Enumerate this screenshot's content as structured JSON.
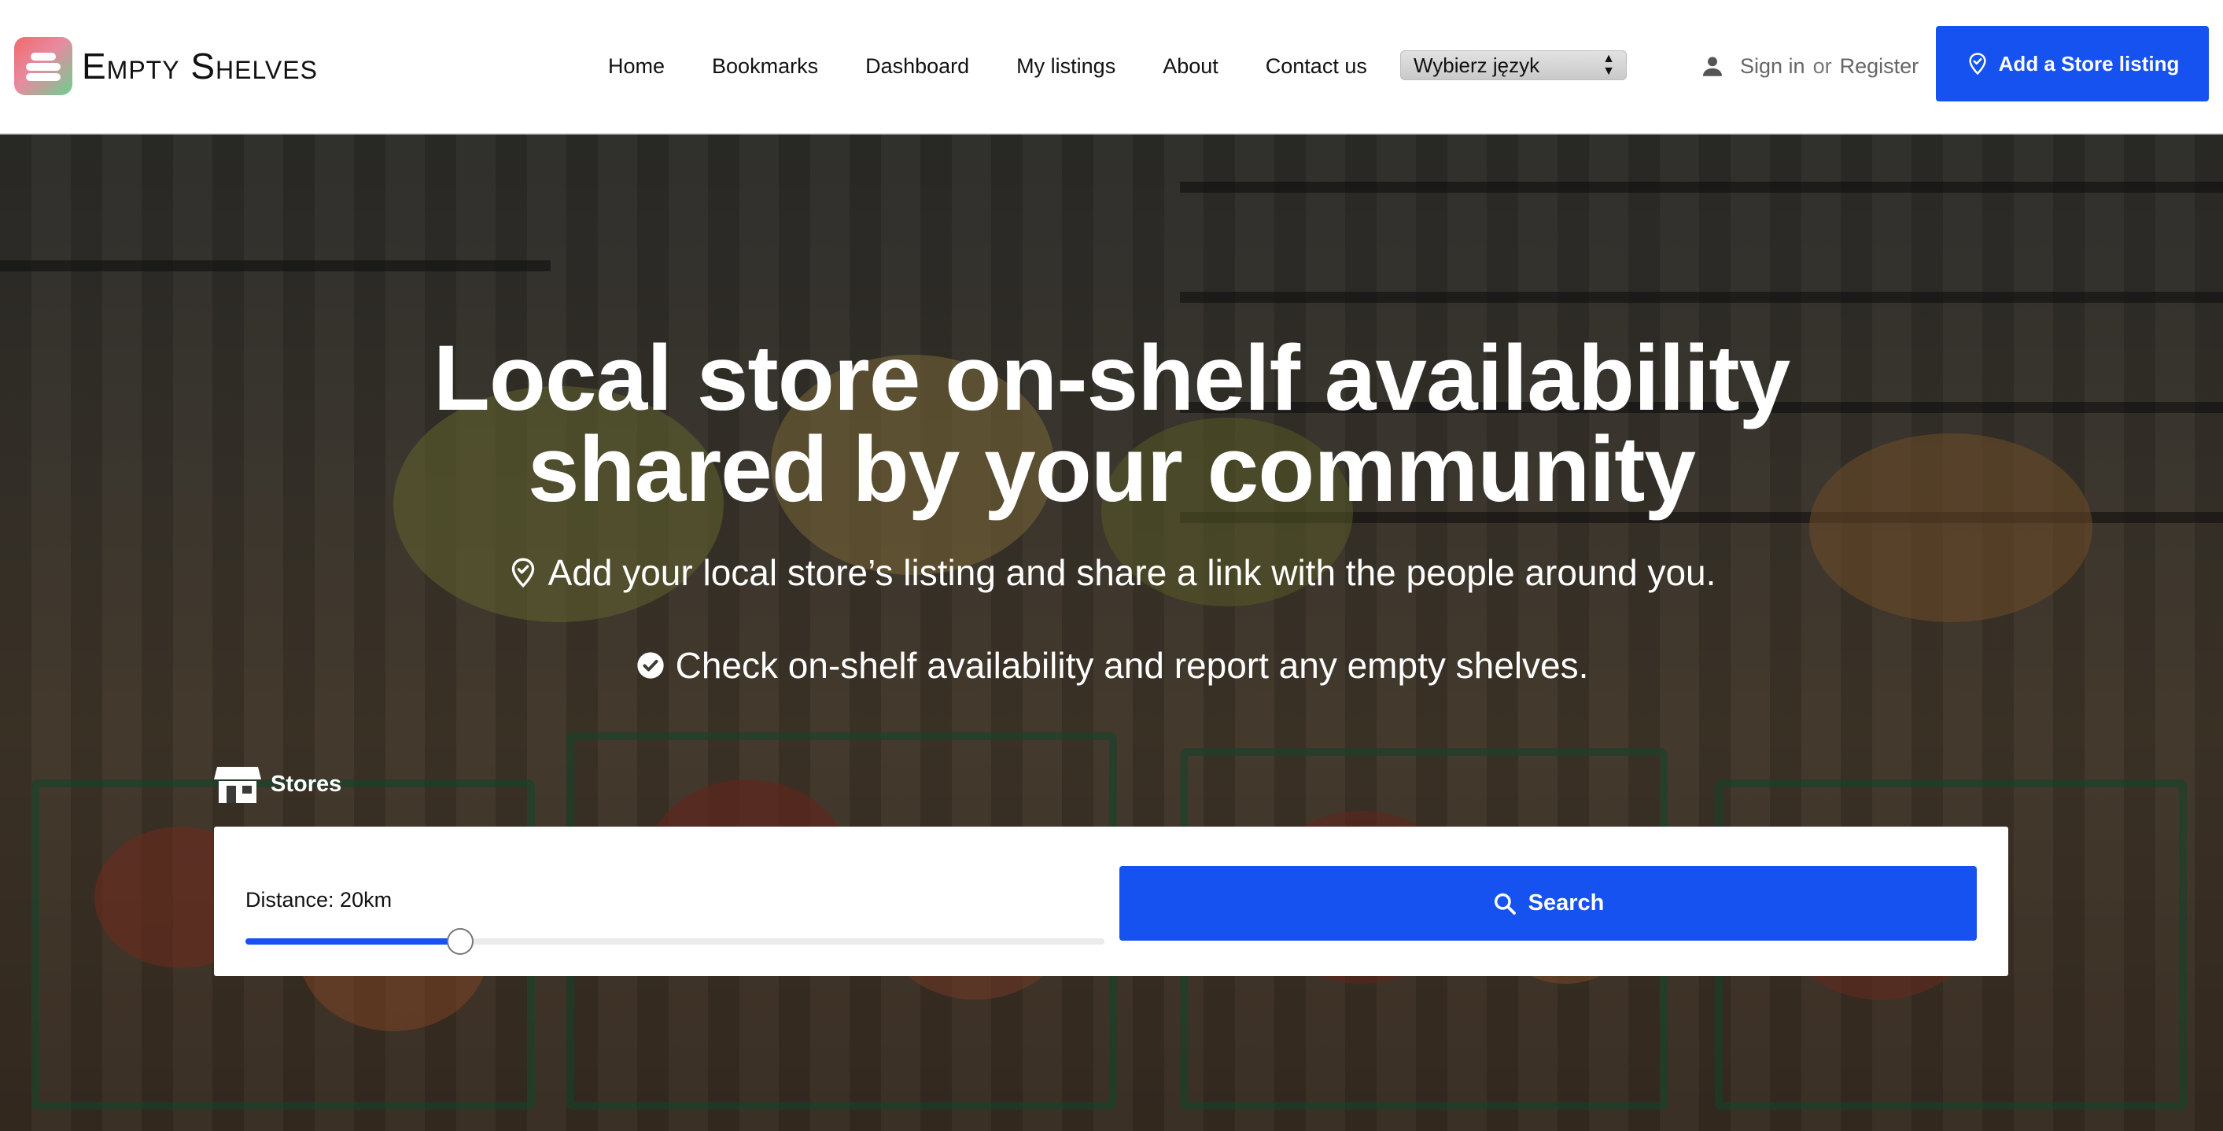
{
  "brand": {
    "name": "Empty Shelves",
    "logo_icon": "shelves-logo-icon"
  },
  "nav": {
    "items": [
      {
        "label": "Home"
      },
      {
        "label": "Bookmarks"
      },
      {
        "label": "Dashboard"
      },
      {
        "label": "My listings"
      },
      {
        "label": "About"
      },
      {
        "label": "Contact us"
      }
    ]
  },
  "language_select": {
    "selected": "Wybierz język"
  },
  "auth": {
    "icon": "person-icon",
    "sign_in": "Sign in",
    "separator": "or",
    "register": "Register"
  },
  "add_listing_button": {
    "label": "Add a Store listing",
    "icon": "map-pin-check-icon",
    "color": "#1652f0"
  },
  "hero": {
    "headline_line1": "Local store on-shelf availability",
    "headline_line2": "shared by your community",
    "subline1": {
      "icon": "map-pin-check-icon",
      "text": "Add your local store’s listing and share a link with the people around you."
    },
    "subline2": {
      "icon": "check-circle-icon",
      "text": "Check on-shelf availability and report any empty shelves."
    }
  },
  "search": {
    "section_label": "Stores",
    "section_icon": "store-icon",
    "distance_label": "Distance: 20km",
    "distance_fraction": 0.25,
    "button_label": "Search",
    "button_icon": "search-icon",
    "accent_color": "#1652f0"
  }
}
